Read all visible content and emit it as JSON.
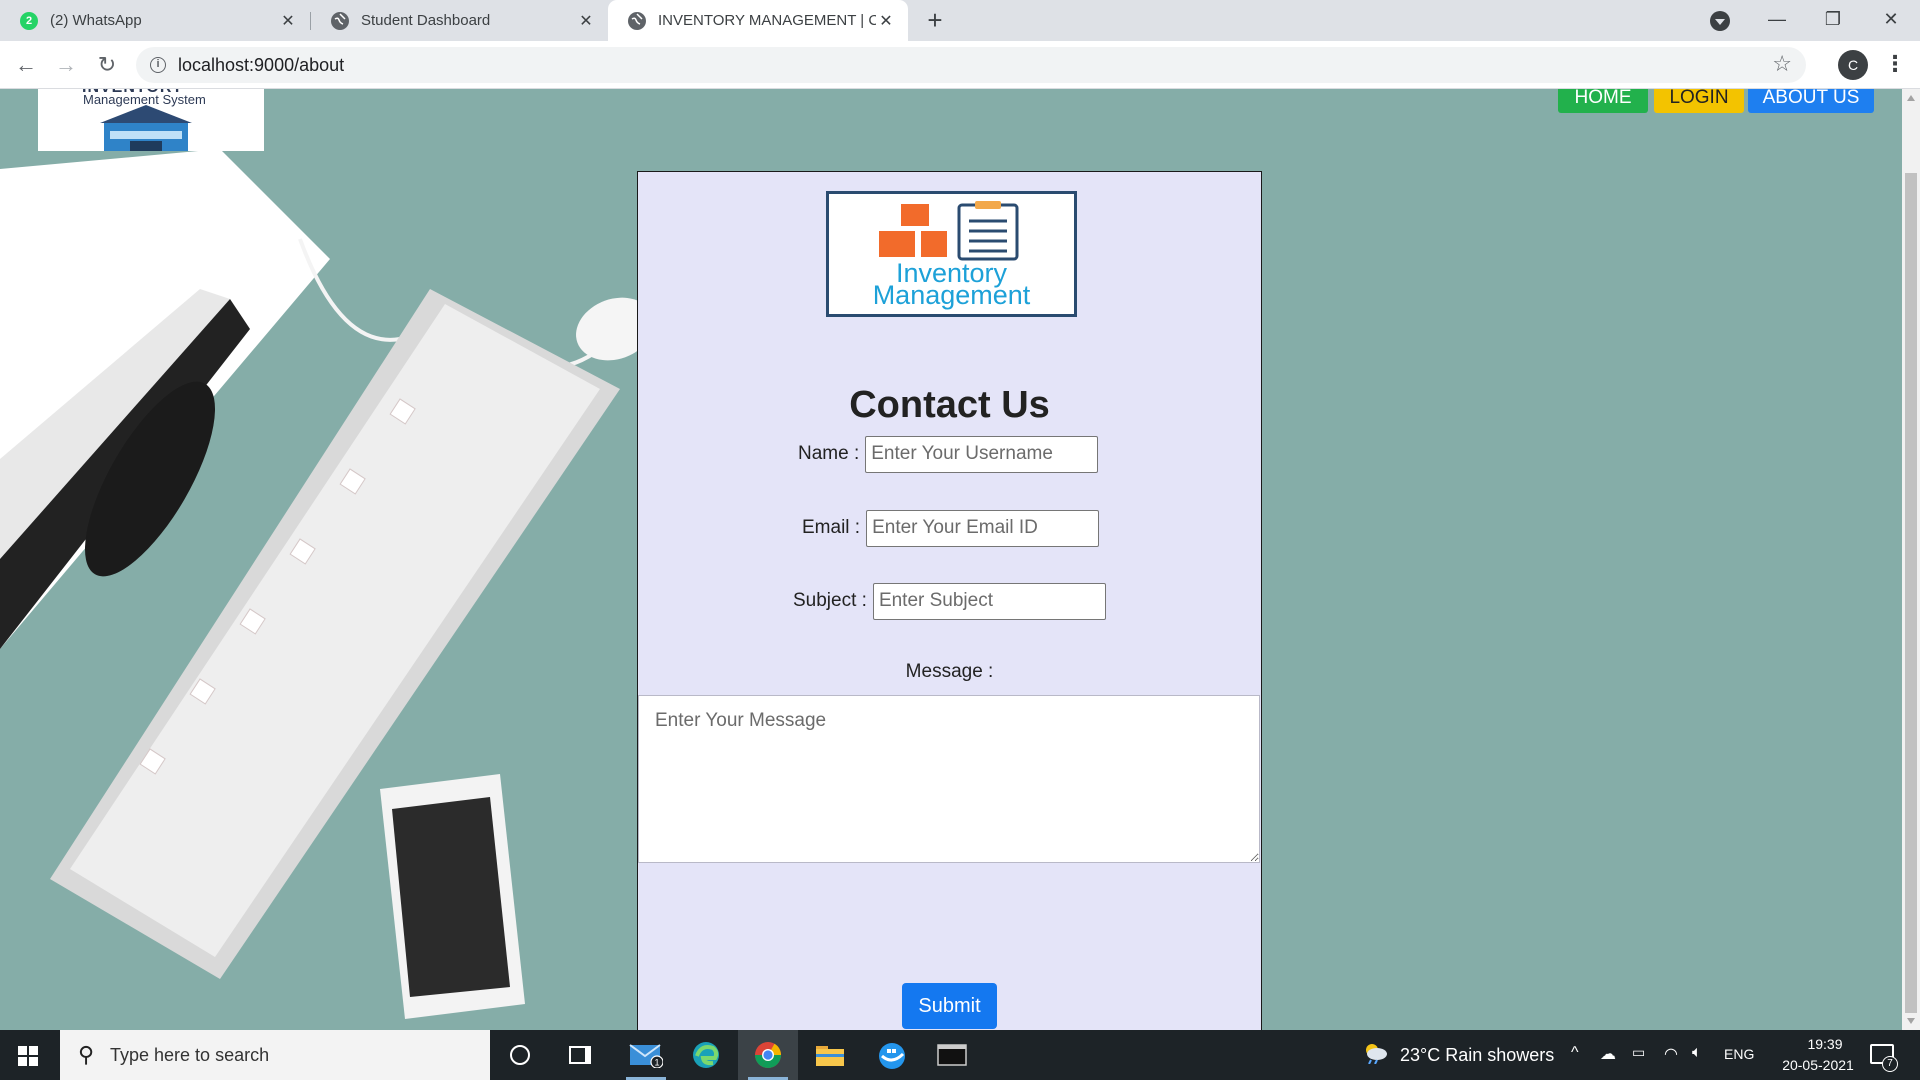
{
  "browser": {
    "tabs": [
      {
        "title": "(2) WhatsApp",
        "badge": "2",
        "active": false
      },
      {
        "title": "Student Dashboard",
        "active": false
      },
      {
        "title": "INVENTORY MANAGEMENT | CO",
        "active": true
      }
    ],
    "url": "localhost:9000/about",
    "profile_initial": "C"
  },
  "site": {
    "logo_heading": "INVENTORY",
    "logo_subtitle": "Management System",
    "nav": [
      {
        "label": "HOME",
        "color": "#22b14c"
      },
      {
        "label": "LOGIN",
        "color": "#f3c300"
      },
      {
        "label": "ABOUT US",
        "color": "#1e7ff0"
      }
    ]
  },
  "contact": {
    "logo_line1": "Inventory",
    "logo_line2": "Management",
    "title": "Contact Us",
    "name_label": "Name :",
    "name_placeholder": "Enter Your Username",
    "email_label": "Email :",
    "email_placeholder": "Enter Your Email ID",
    "subject_label": "Subject :",
    "subject_placeholder": "Enter Subject",
    "message_label": "Message :",
    "message_placeholder": "Enter Your Message",
    "submit_label": "Submit"
  },
  "taskbar": {
    "search_placeholder": "Type here to search",
    "mail_badge": "1",
    "weather": "23°C  Rain showers",
    "language": "ENG",
    "time": "19:39",
    "date": "20-05-2021",
    "notification_count": "7"
  },
  "colors": {
    "page_background": "#85ada8",
    "card_background": "#e4e4f8",
    "submit": "#1478f0"
  }
}
